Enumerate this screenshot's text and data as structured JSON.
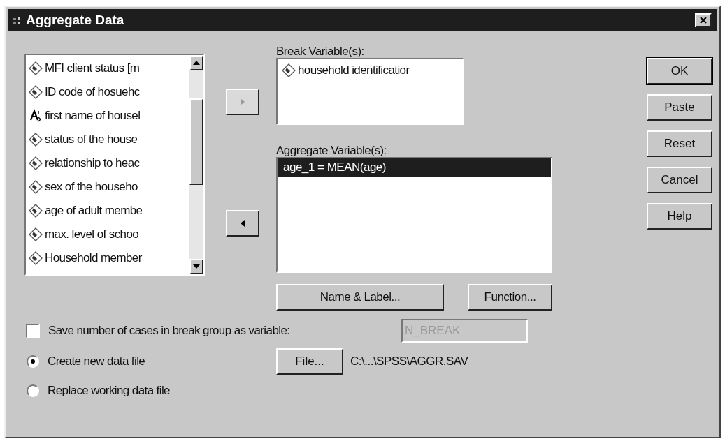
{
  "window": {
    "title": "Aggregate Data"
  },
  "source_list": {
    "items": [
      {
        "kind": "numeric",
        "label": "MFI client status [m"
      },
      {
        "kind": "numeric",
        "label": "ID code of hosuehc"
      },
      {
        "kind": "string",
        "label": "first name of housel"
      },
      {
        "kind": "numeric",
        "label": "status of the house"
      },
      {
        "kind": "numeric",
        "label": "relationship to heac"
      },
      {
        "kind": "numeric",
        "label": "sex of the househo"
      },
      {
        "kind": "numeric",
        "label": "age of adult membe"
      },
      {
        "kind": "numeric",
        "label": "max. level of schoo"
      },
      {
        "kind": "numeric",
        "label": "Household member"
      }
    ]
  },
  "move_buttons": [
    {
      "kind": "right",
      "disabled": true
    },
    {
      "kind": "left",
      "disabled": false
    }
  ],
  "break_variables": {
    "label": "Break Variable(s):",
    "items": [
      {
        "kind": "numeric",
        "label": "household identificatior"
      }
    ]
  },
  "aggregate_variables": {
    "label": "Aggregate Variable(s):",
    "items": [
      {
        "label": "age_1 = MEAN(age)",
        "selected": true
      }
    ]
  },
  "aggregate_buttons": [
    "Name & Label...",
    "Function..."
  ],
  "side_buttons": [
    {
      "label": "OK",
      "default": true
    },
    {
      "label": "Paste",
      "default": false
    },
    {
      "label": "Reset",
      "default": false
    },
    {
      "label": "Cancel",
      "default": false
    },
    {
      "label": "Help",
      "default": false
    }
  ],
  "save_count": {
    "label": "Save number of cases in break group as variable:",
    "checked": false,
    "field_value": "N_BREAK",
    "field_disabled": true
  },
  "output_options": [
    {
      "label": "Create new data file",
      "selected": true
    },
    {
      "label": "Replace working data file",
      "selected": false
    }
  ],
  "file_button": "File...",
  "file_path": "C:\\...\\SPSS\\AGGR.SAV"
}
